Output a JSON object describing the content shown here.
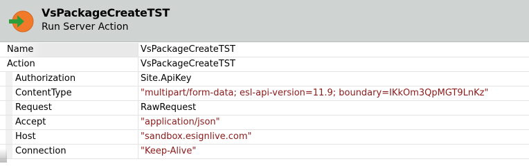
{
  "header": {
    "title": "VsPackageCreateTST",
    "subtitle": "Run Server Action",
    "icon": "run-server-action-icon",
    "colors": {
      "icon_circle": "#f07a2a",
      "icon_arrow": "#2e9e3a",
      "header_bg": "#cfd4d3"
    }
  },
  "properties": [
    {
      "name": "Name",
      "value": "VsPackageCreateTST",
      "type": "plain"
    },
    {
      "name": "Action",
      "value": "VsPackageCreateTST",
      "type": "plain"
    },
    {
      "name": "Authorization",
      "value": "Site.ApiKey",
      "type": "plain"
    },
    {
      "name": "ContentType",
      "value": "\"multipart/form-data; esl-api-version=11.9; boundary=IKkOm3QpMGT9LnKz\"",
      "type": "string"
    },
    {
      "name": "Request",
      "value": "RawRequest",
      "type": "plain"
    },
    {
      "name": "Accept",
      "value": "\"application/json\"",
      "type": "string"
    },
    {
      "name": "Host",
      "value": "\"sandbox.esignlive.com\"",
      "type": "string"
    },
    {
      "name": "Connection",
      "value": "\"Keep-Alive\"",
      "type": "string"
    }
  ],
  "colors": {
    "string_value": "#8b1a1a"
  }
}
